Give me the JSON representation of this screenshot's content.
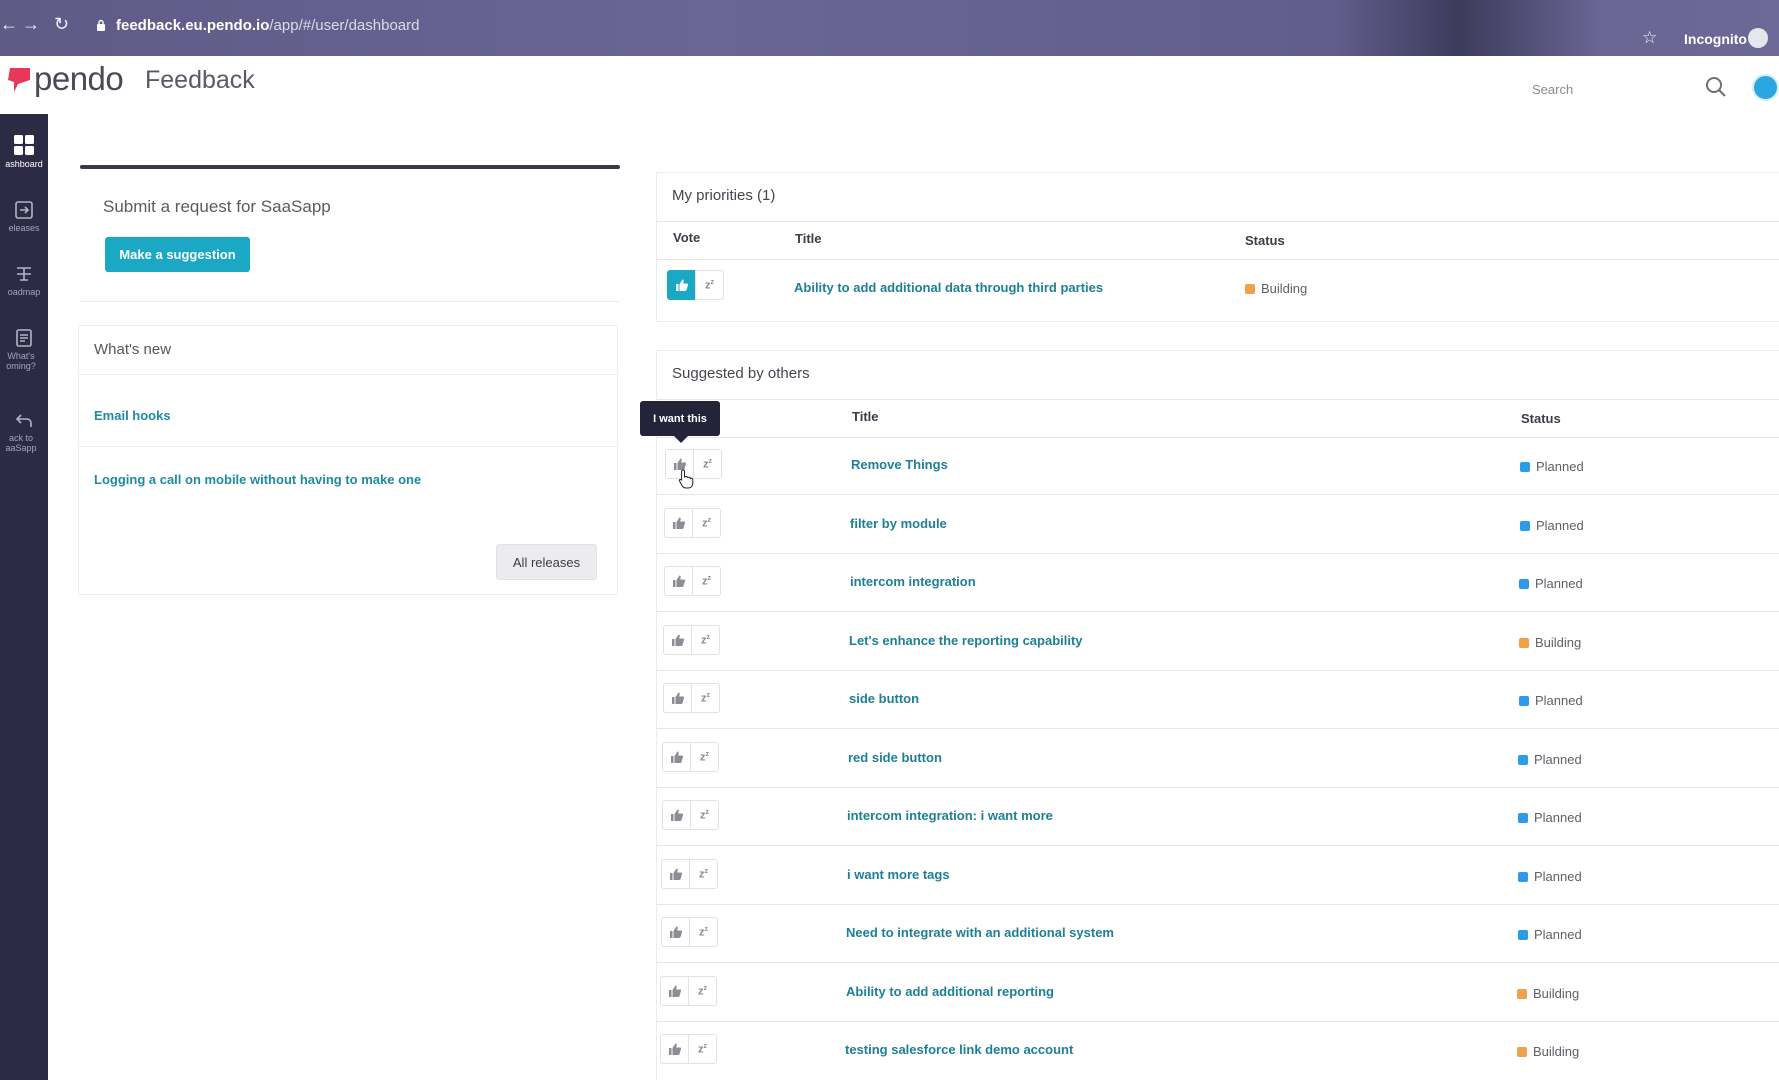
{
  "browser": {
    "url_host": "feedback.eu.pendo.io",
    "url_path": "/app/#/user/dashboard",
    "mode_label": "Incognito"
  },
  "header": {
    "logo": "pendo",
    "product": "Feedback",
    "search_placeholder": "Search"
  },
  "rail": {
    "items": [
      {
        "label": "ashboard",
        "icon": "dashboard-icon"
      },
      {
        "label": "eleases",
        "icon": "releases-icon"
      },
      {
        "label": "oadmap",
        "icon": "roadmap-icon"
      },
      {
        "label": "What's oming?",
        "icon": "whats-coming-icon"
      },
      {
        "label": "ack to aaSapp",
        "icon": "back-arrow-icon"
      }
    ]
  },
  "submit": {
    "title": "Submit a request for SaaSapp",
    "button": "Make a suggestion"
  },
  "whats_new": {
    "title": "What's new",
    "items": [
      "Email hooks",
      "Logging a call on mobile without having to make one"
    ],
    "all_button": "All releases"
  },
  "priorities": {
    "title": "My priorities (1)",
    "columns": {
      "vote": "Vote",
      "title": "Title",
      "status": "Status"
    },
    "rows": [
      {
        "title": "Ability to add additional data through third parties",
        "status": "Building",
        "voted": true
      }
    ]
  },
  "suggested": {
    "title": "Suggested by others",
    "columns": {
      "title": "Title",
      "status": "Status"
    },
    "tooltip": "I want this",
    "rows": [
      {
        "title": "Remove Things",
        "status": "Planned"
      },
      {
        "title": "filter by module",
        "status": "Planned"
      },
      {
        "title": "intercom integration",
        "status": "Planned"
      },
      {
        "title": "Let's enhance the reporting capability",
        "status": "Building"
      },
      {
        "title": "side button",
        "status": "Planned"
      },
      {
        "title": "red side button",
        "status": "Planned"
      },
      {
        "title": "intercom integration: i want more",
        "status": "Planned"
      },
      {
        "title": "i want more tags",
        "status": "Planned"
      },
      {
        "title": "Need to integrate with an additional system",
        "status": "Planned"
      },
      {
        "title": "Ability to add additional reporting",
        "status": "Building"
      },
      {
        "title": "testing salesforce link demo account",
        "status": "Building"
      }
    ]
  },
  "status_colors": {
    "Planned": "#2d9be6",
    "Building": "#f0a14b"
  }
}
